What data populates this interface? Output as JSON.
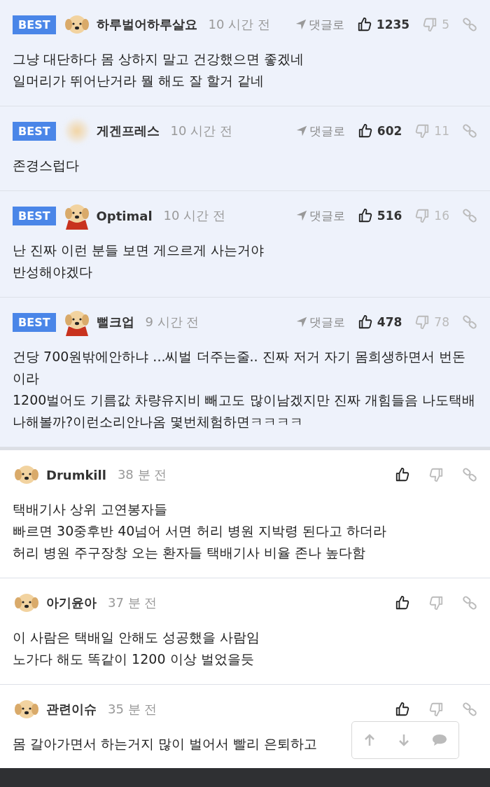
{
  "comments": [
    {
      "best": true,
      "badge": "BEST",
      "avatar": {
        "kind": "puppy"
      },
      "name": "하루벌어하루살요",
      "time": "10 시간 전",
      "reply": "댓글로",
      "likes": "1235",
      "dislikes": "5",
      "paragraphs": [
        "그냥 대단하다 몸 상하지 말고 건강했으면 좋겠네",
        "일머리가 뛰어난거라 뭘 해도 잘 할거 같네"
      ]
    },
    {
      "best": true,
      "badge": "BEST",
      "avatar": {
        "kind": "blurred"
      },
      "name": "게겐프레스",
      "time": "10 시간 전",
      "reply": "댓글로",
      "likes": "602",
      "dislikes": "11",
      "paragraphs": [
        "존경스럽다"
      ]
    },
    {
      "best": true,
      "badge": "BEST",
      "avatar": {
        "kind": "caped"
      },
      "name": "Optimal",
      "time": "10 시간 전",
      "reply": "댓글로",
      "likes": "516",
      "dislikes": "16",
      "paragraphs": [
        "난 진짜 이런 분들 보면 게으르게 사는거야",
        "반성해야겠다"
      ]
    },
    {
      "best": true,
      "badge": "BEST",
      "avatar": {
        "kind": "caped"
      },
      "name": "뻘크업",
      "time": "9 시간 전",
      "reply": "댓글로",
      "likes": "478",
      "dislikes": "78",
      "paragraphs": [
        "건당 700원밖에안하냐 ...씨벌 더주는줄.. 진짜 저거 자기 몸희생하면서 번돈이라",
        "1200벌어도 기름값 차량유지비 빼고도 많이남겠지만 진짜 개힘들음 나도택배나해볼까?이런소리안나옴 몇번체험하면ㅋㅋㅋㅋ"
      ]
    },
    {
      "best": false,
      "avatar": {
        "kind": "puppy"
      },
      "name": "Drumkill",
      "time": "38 분 전",
      "paragraphs": [
        "택배기사 상위 고연봉자들",
        "빠르면 30중후반 40넘어 서면 허리 병원 지박령 된다고 하더라",
        "허리 병원 주구장창 오는 환자들 택배기사 비율 존나 높다함"
      ]
    },
    {
      "best": false,
      "avatar": {
        "kind": "puppy"
      },
      "name": "아기윤아",
      "time": "37 분 전",
      "paragraphs": [
        "이 사람은 택배일 안해도 성공했을 사람임",
        "노가다 해도 똑같이 1200 이상 벌었을듯"
      ]
    },
    {
      "best": false,
      "avatar": {
        "kind": "puppy"
      },
      "name": "관련이슈",
      "time": "35 분 전",
      "paragraphs": [
        "몸 갈아가면서 하는거지 많이 벌어서 빨리 은퇴하고"
      ]
    }
  ]
}
